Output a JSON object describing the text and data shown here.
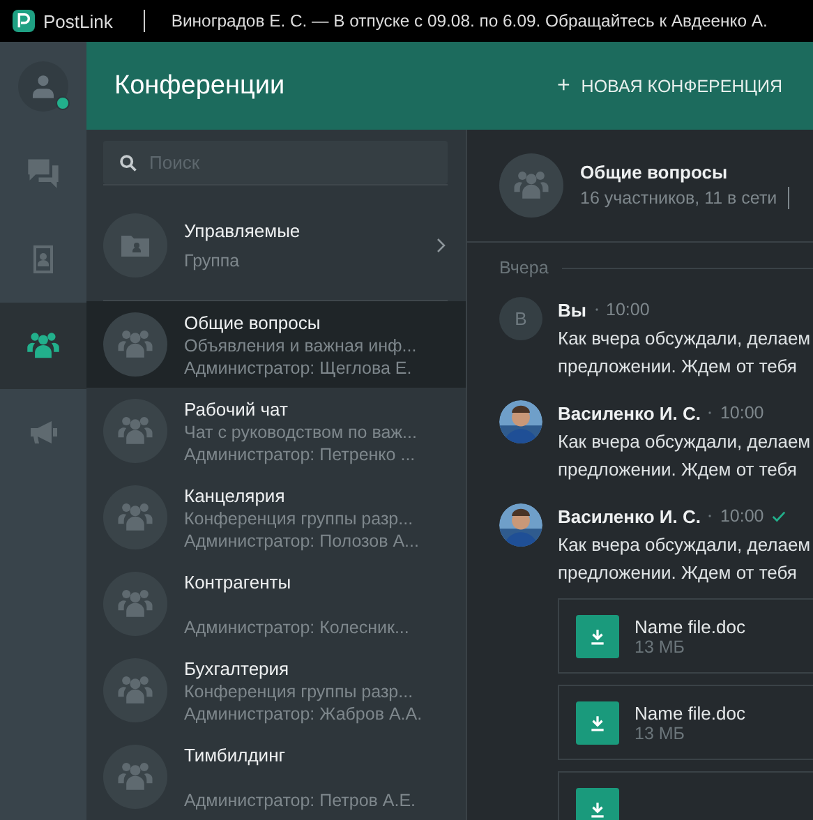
{
  "app": {
    "name": "PostLink",
    "status_text": "Виноградов Е. С. — В отпуске с 09.08. по 6.09. Обращайтесь к Авдеенко А."
  },
  "rail": {
    "profile": {
      "online": true
    },
    "items": [
      {
        "kind": "chats",
        "selected": false
      },
      {
        "kind": "contacts",
        "selected": false
      },
      {
        "kind": "conferences",
        "selected": true
      },
      {
        "kind": "announcements",
        "selected": false
      }
    ]
  },
  "header": {
    "title": "Конференции",
    "action": {
      "icon": "+",
      "label": "НОВАЯ КОНФЕРЕНЦИЯ"
    }
  },
  "search": {
    "placeholder": "Поиск"
  },
  "list": [
    {
      "kind": "group",
      "title": "Управляемые",
      "subtitle": "Группа"
    },
    {
      "kind": "conference",
      "title": "Общие вопросы",
      "description": "Объявления и важная инф...",
      "admin": "Администратор: Щеглова Е.",
      "selected": true
    },
    {
      "kind": "conference",
      "title": "Рабочий чат",
      "description": "Чат с руководством по важ...",
      "admin": "Администратор: Петренко ...",
      "selected": false
    },
    {
      "kind": "conference",
      "title": "Канцелярия",
      "description": "Конференция группы разр...",
      "admin": "Администратор: Полозов А...",
      "selected": false
    },
    {
      "kind": "conference",
      "title": "Контрагенты",
      "admin": "Администратор: Колесник...",
      "selected": false
    },
    {
      "kind": "conference",
      "title": "Бухгалтерия",
      "description": "Конференция группы разр...",
      "admin": "Администратор: Жабров А.А.",
      "selected": false
    },
    {
      "kind": "conference",
      "title": "Тимбилдинг",
      "admin": "Администратор: Петров А.Е.",
      "selected": false
    }
  ],
  "chat": {
    "title": "Общие вопросы",
    "subtitle": "16 участников, 11 в сети",
    "day": "Вчера",
    "messages": [
      {
        "avatar": {
          "kind": "letter",
          "initial": "В"
        },
        "author": "Вы",
        "time": "10:00",
        "read": false,
        "lines": [
          "Как вчера обсуждали, делаем",
          "предложении.  Ждем от тебя"
        ]
      },
      {
        "avatar": {
          "kind": "photo"
        },
        "author": "Василенко И. С.",
        "time": "10:00",
        "read": false,
        "lines": [
          "Как вчера обсуждали, делаем",
          "предложении.  Ждем от тебя"
        ]
      },
      {
        "avatar": {
          "kind": "photo"
        },
        "author": "Василенко И. С.",
        "time": "10:00",
        "read": true,
        "lines": [
          "Как вчера обсуждали, делаем",
          "предложении.  Ждем от тебя"
        ],
        "files": [
          {
            "kind": "file",
            "name": "Name file.doc",
            "size": "13  МБ"
          },
          {
            "kind": "file",
            "name": "Name file.doc",
            "size": "13  МБ"
          },
          {
            "kind": "partial"
          }
        ]
      }
    ]
  }
}
